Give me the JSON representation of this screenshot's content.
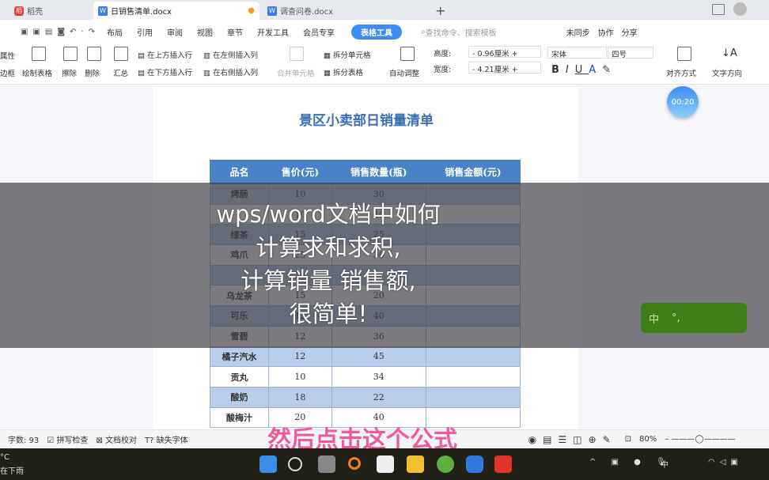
{
  "tabs": [
    {
      "label": "稻壳"
    },
    {
      "label": "日销售清单.docx"
    },
    {
      "label": "调查问卷.docx"
    }
  ],
  "new_tab": "+",
  "menu": {
    "items": [
      "布局",
      "引用",
      "审阅",
      "视图",
      "章节",
      "开发工具",
      "会员专享"
    ],
    "table_tools": "表格工具",
    "search_placeholder": "查找命令、搜索模板",
    "sync": "未同步",
    "collab": "协作",
    "share": "分享"
  },
  "ribbon": {
    "prop": "属性",
    "border": "边框",
    "draw_table": "绘制表格",
    "erase": "擦除",
    "delete": "删除",
    "summary": "汇总",
    "insert_above": "在上方插入行",
    "insert_below": "在下方插入行",
    "insert_left": "在左侧插入列",
    "insert_right": "在右侧插入列",
    "merge": "合并单元格",
    "split_cell": "拆分单元格",
    "split_table": "拆分表格",
    "auto_fit": "自动调整",
    "height_label": "高度:",
    "height_value": "0.96厘米",
    "width_label": "宽度:",
    "width_value": "4.21厘米",
    "font": "宋体",
    "size": "四号",
    "align": "对齐方式",
    "text_dir": "文字方向"
  },
  "doc": {
    "title": "景区小卖部日销量清单",
    "headers": [
      "品名",
      "售价(元)",
      "销售数量(瓶)",
      "销售金额(元)"
    ],
    "rows": [
      [
        "烤肠",
        "10",
        "30",
        ""
      ],
      [
        "",
        "10",
        "40",
        ""
      ],
      [
        "绿茶",
        "15",
        "25",
        ""
      ],
      [
        "鸡爪",
        "25",
        "30",
        ""
      ],
      [
        "",
        "20",
        "",
        ""
      ],
      [
        "乌龙茶",
        "15",
        "20",
        ""
      ],
      [
        "可乐",
        "12",
        "40",
        ""
      ],
      [
        "雪碧",
        "12",
        "36",
        ""
      ],
      [
        "橘子汽水",
        "12",
        "45",
        ""
      ],
      [
        "贡丸",
        "10",
        "34",
        ""
      ],
      [
        "酸奶",
        "18",
        "22",
        ""
      ],
      [
        "酸梅汁",
        "20",
        "40",
        ""
      ]
    ]
  },
  "overlay": {
    "lines": [
      "wps/word文档中如何",
      "计算求和求积,",
      "计算销量 销售额,",
      "很简单!"
    ]
  },
  "caption": "然后点击这个公式",
  "timer": "00:20",
  "ime": {
    "mode": "中",
    "punct": "°,"
  },
  "status": {
    "word_count": "字数: 93",
    "spell": "拼写检查",
    "proof": "文档校对",
    "missing_font": "缺失字体",
    "zoom": "80%"
  },
  "taskbar": {
    "weather_temp": "°C",
    "weather_desc": "在下雨",
    "lang": "中"
  },
  "colors": {
    "header_blue": "#4a82c8",
    "row_blue": "#b9cdea",
    "accent": "#3d8ef0",
    "caption": "#ef5a9c"
  }
}
